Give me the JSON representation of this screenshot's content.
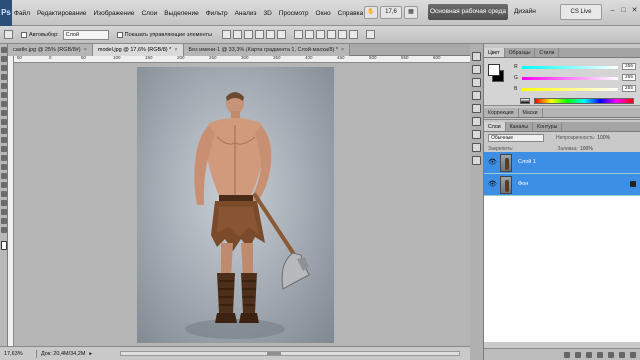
{
  "menu": {
    "logo": "Ps",
    "items": [
      "Файл",
      "Редактирование",
      "Изображение",
      "Слои",
      "Выделение",
      "Фильтр",
      "Анализ",
      "3D",
      "Просмотр",
      "Окно",
      "Справка"
    ],
    "zoom_field": "17,6",
    "workspace_button": "Основная рабочая среда",
    "design_label": "Дизайн",
    "cs_live": "CS Live",
    "window_controls": [
      "–",
      "□",
      "✕"
    ]
  },
  "options": {
    "autoselect_label": "Автовыбор:",
    "autoselect_value": "Слой",
    "show_controls_label": "Показать управляющие элементы"
  },
  "tabs": [
    {
      "label": "castle.jpg @ 25% (RGB/8#)",
      "active": false
    },
    {
      "label": "model.jpg @ 17,6% (RGB/8) *",
      "active": true
    },
    {
      "label": "Без имени-1 @ 33,3% (Карта градиента 1, Слой-маска/8) *",
      "active": false
    }
  ],
  "ruler_labels": [
    "50",
    "0",
    "50",
    "100",
    "150",
    "200",
    "250",
    "300",
    "350",
    "400",
    "450",
    "500",
    "550",
    "600"
  ],
  "status": {
    "zoom": "17,63%",
    "doc_info": "Док: 20,4M/34,2M"
  },
  "color_panel": {
    "tabs": [
      "Цвет",
      "Образцы",
      "Стили"
    ],
    "sliders": [
      {
        "label": "R",
        "value": "255",
        "gradient_from": "#00ffff",
        "gradient_to": "#ffffff"
      },
      {
        "label": "G",
        "value": "255",
        "gradient_from": "#ff00ff",
        "gradient_to": "#ffffff"
      },
      {
        "label": "B",
        "value": "255",
        "gradient_from": "#ffff00",
        "gradient_to": "#ffffff"
      }
    ],
    "foreground": "#ffffff",
    "background": "#000000"
  },
  "adjust_panel": {
    "tabs": [
      "Коррекция",
      "Маски"
    ]
  },
  "layers_panel": {
    "tabs": [
      "Слои",
      "Каналы",
      "Контуры"
    ],
    "blend_mode": "Обычные",
    "opacity_label": "Непрозрачность:",
    "opacity_value": "100%",
    "lock_label": "Закрепить:",
    "fill_label": "Заливка:",
    "fill_value": "100%",
    "layers": [
      {
        "name": "Слой 1",
        "selected": true,
        "visible": true
      },
      {
        "name": "Фон",
        "selected": true,
        "visible": true
      }
    ],
    "selection_color": "#3d8fe6"
  }
}
